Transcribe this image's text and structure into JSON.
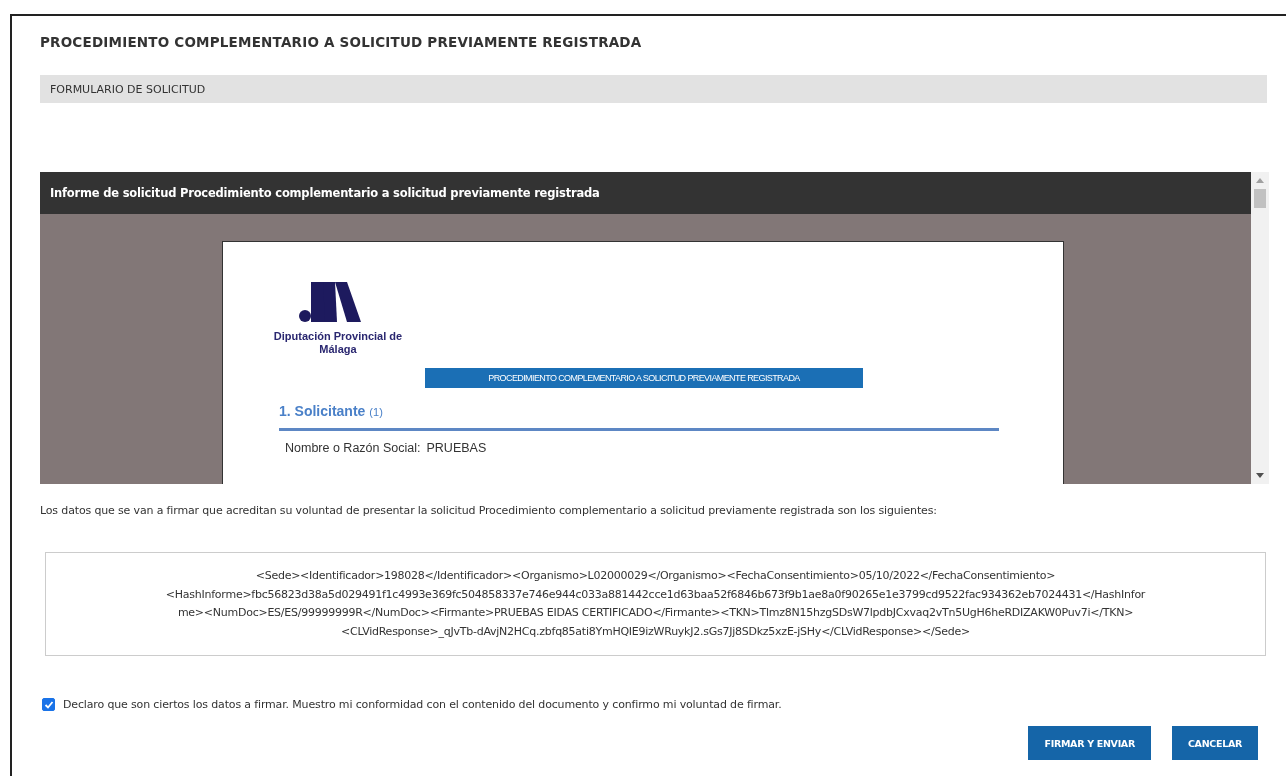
{
  "page": {
    "title": "PROCEDIMIENTO COMPLEMENTARIO A SOLICITUD PREVIAMENTE REGISTRADA",
    "section": "FORMULARIO DE SOLICITUD"
  },
  "viewer": {
    "title": "Informe de solicitud Procedimiento complementario a solicitud previamente registrada",
    "document": {
      "org_name": "Diputación Provincial de Málaga",
      "banner": "PROCEDIMIENTO COMPLEMENTARIO A SOLICITUD PREVIAMENTE REGISTRADA",
      "section_heading": "1. Solicitante",
      "section_note": "(1)",
      "fields": [
        {
          "label": "Nombre o Razón Social:",
          "value": "PRUEBAS"
        }
      ]
    }
  },
  "intro": "Los datos que se van a firmar que acreditan su voluntad de presentar la solicitud Procedimiento complementario a solicitud previamente registrada son los siguientes:",
  "signed_data": [
    "<Sede><Identificador>198028</Identificador><Organismo>L02000029</Organismo><FechaConsentimiento>05/10/2022</FechaConsentimiento>",
    "<HashInforme>fbc56823d38a5d029491f1c4993e369fc504858337e746e944c033a881442cce1d63baa52f6846b673f9b1ae8a0f90265e1e3799cd9522fac934362eb7024431</HashInfor",
    "me><NumDoc>ES/ES/99999999R</NumDoc><Firmante>PRUEBAS EIDAS CERTIFICADO</Firmante><TKN>Tlmz8N15hzgSDsW7lpdbJCxvaq2vTn5UgH6heRDIZAKW0Puv7i</TKN>",
    "<CLVidResponse>_qJvTb-dAvjN2HCq.zbfq85ati8YmHQIE9izWRuykJ2.sGs7Jj8SDkz5xzE-jSHy</CLVidResponse></Sede>"
  ],
  "consent": {
    "label": "Declaro que son ciertos los datos a firmar. Muestro mi conformidad con el contenido del documento y confirmo mi voluntad de firmar.",
    "checked": true
  },
  "buttons": [
    {
      "label": "FIRMAR Y ENVIAR"
    },
    {
      "label": "CANCELAR"
    }
  ]
}
